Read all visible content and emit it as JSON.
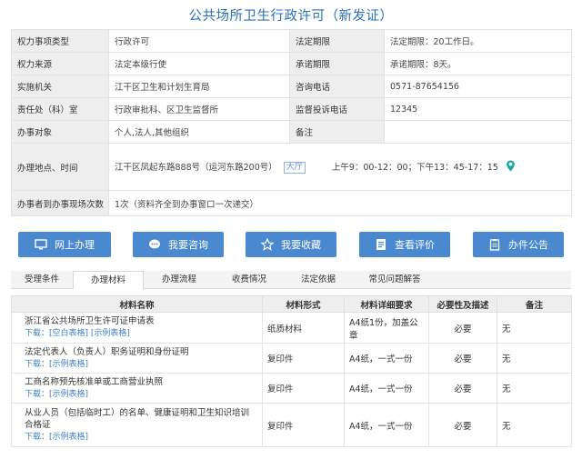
{
  "page": {
    "title": "公共场所卫生行政许可（新发证）"
  },
  "info": {
    "item_type_label": "权力事项类型",
    "item_type_value": "行政许可",
    "legal_limit_label": "法定期限",
    "legal_limit_value": "法定期限：20工作日。",
    "source_label": "权力来源",
    "source_value": "法定本级行使",
    "promise_limit_label": "承诺期限",
    "promise_limit_value": "承诺期限：8天。",
    "agency_label": "实施机关",
    "agency_value": "江干区卫生和计划生育局",
    "phone_label": "咨询电话",
    "phone_value": "0571-87654156",
    "dept_label": "责任处（科）室",
    "dept_value": "行政审批科、区卫生监督所",
    "complaint_label": "监督投诉电话",
    "complaint_value": "12345",
    "target_label": "办事对象",
    "target_value": "个人,法人,其他组织",
    "remark_label": "备注",
    "remark_value": "",
    "address_label": "办理地点、时间",
    "address_value": "江干区凤起东路888号（运河东路200号）",
    "hall_label": "大厅",
    "hours_value": "上午9：00-12：00；下午13：45-17：15",
    "visits_label": "办事者到办事现场次数",
    "visits_value": "1次（资料齐全到办事窗口一次递交）"
  },
  "buttons": {
    "online": "网上办理",
    "consult": "我要咨询",
    "favorite": "我要收藏",
    "review": "查看评价",
    "notice": "办件公告"
  },
  "tabs": [
    "受理条件",
    "办理材料",
    "办理流程",
    "收费情况",
    "法定依据",
    "常见问题解答"
  ],
  "colors": {
    "accent": "#4a88cf",
    "title": "#2a6fb8",
    "pin": "#1aa6a0"
  },
  "materials": {
    "headers": [
      "材料名称",
      "材料形式",
      "材料详细要求",
      "必要性及描述",
      "备注"
    ],
    "download_label": "下载：",
    "rows": [
      {
        "name": "浙江省公共场所卫生许可证申请表",
        "links": "[空白表格] [示例表格]",
        "form": "纸质材料",
        "requirement": "A4纸1份，加盖公章",
        "necessity": "必要",
        "remark": "无"
      },
      {
        "name": "法定代表人（负责人）职务证明和身份证明",
        "links": "[示例表格]",
        "form": "复印件",
        "requirement": "A4纸，一式一份",
        "necessity": "必要",
        "remark": "无"
      },
      {
        "name": "工商名称预先核准单或工商营业执照",
        "links": "[示例表格]",
        "form": "复印件",
        "requirement": "A4纸，一式一份",
        "necessity": "必要",
        "remark": "无"
      },
      {
        "name": "从业人员（包括临时工）的名单、健康证明和卫生知识培训合格证",
        "links": "[示例表格]",
        "form": "复印件",
        "requirement": "A4纸，一式一份",
        "necessity": "必要",
        "remark": "无"
      }
    ]
  }
}
